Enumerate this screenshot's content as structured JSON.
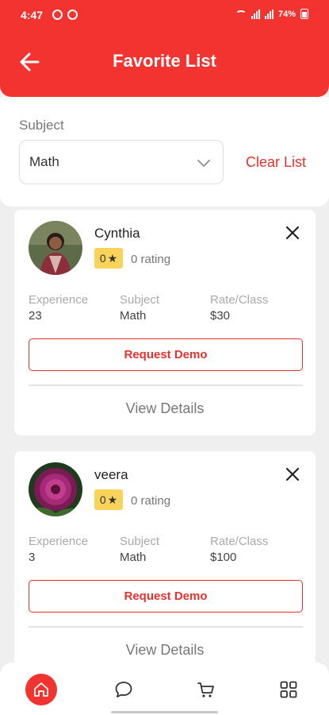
{
  "status_bar": {
    "time": "4:47",
    "battery": "74%"
  },
  "header": {
    "title": "Favorite List"
  },
  "filter": {
    "subject_label": "Subject",
    "subject_value": "Math",
    "clear_label": "Clear List"
  },
  "tutors": [
    {
      "name": "Cynthia",
      "rating_value": "0",
      "rating_text": "0 rating",
      "experience_label": "Experience",
      "experience": "23",
      "subject_label": "Subject",
      "subject": "Math",
      "rate_label": "Rate/Class",
      "rate": "$30",
      "request_label": "Request Demo",
      "details_label": "View Details"
    },
    {
      "name": "veera",
      "rating_value": "0",
      "rating_text": "0 rating",
      "experience_label": "Experience",
      "experience": "3",
      "subject_label": "Subject",
      "subject": "Math",
      "rate_label": "Rate/Class",
      "rate": "$100",
      "request_label": "Request Demo",
      "details_label": "View Details"
    }
  ],
  "nav": [
    "home-icon",
    "chat-icon",
    "cart-icon",
    "grid-icon"
  ],
  "colors": {
    "primary": "#f2332f",
    "rating_badge": "#f7d35a"
  }
}
